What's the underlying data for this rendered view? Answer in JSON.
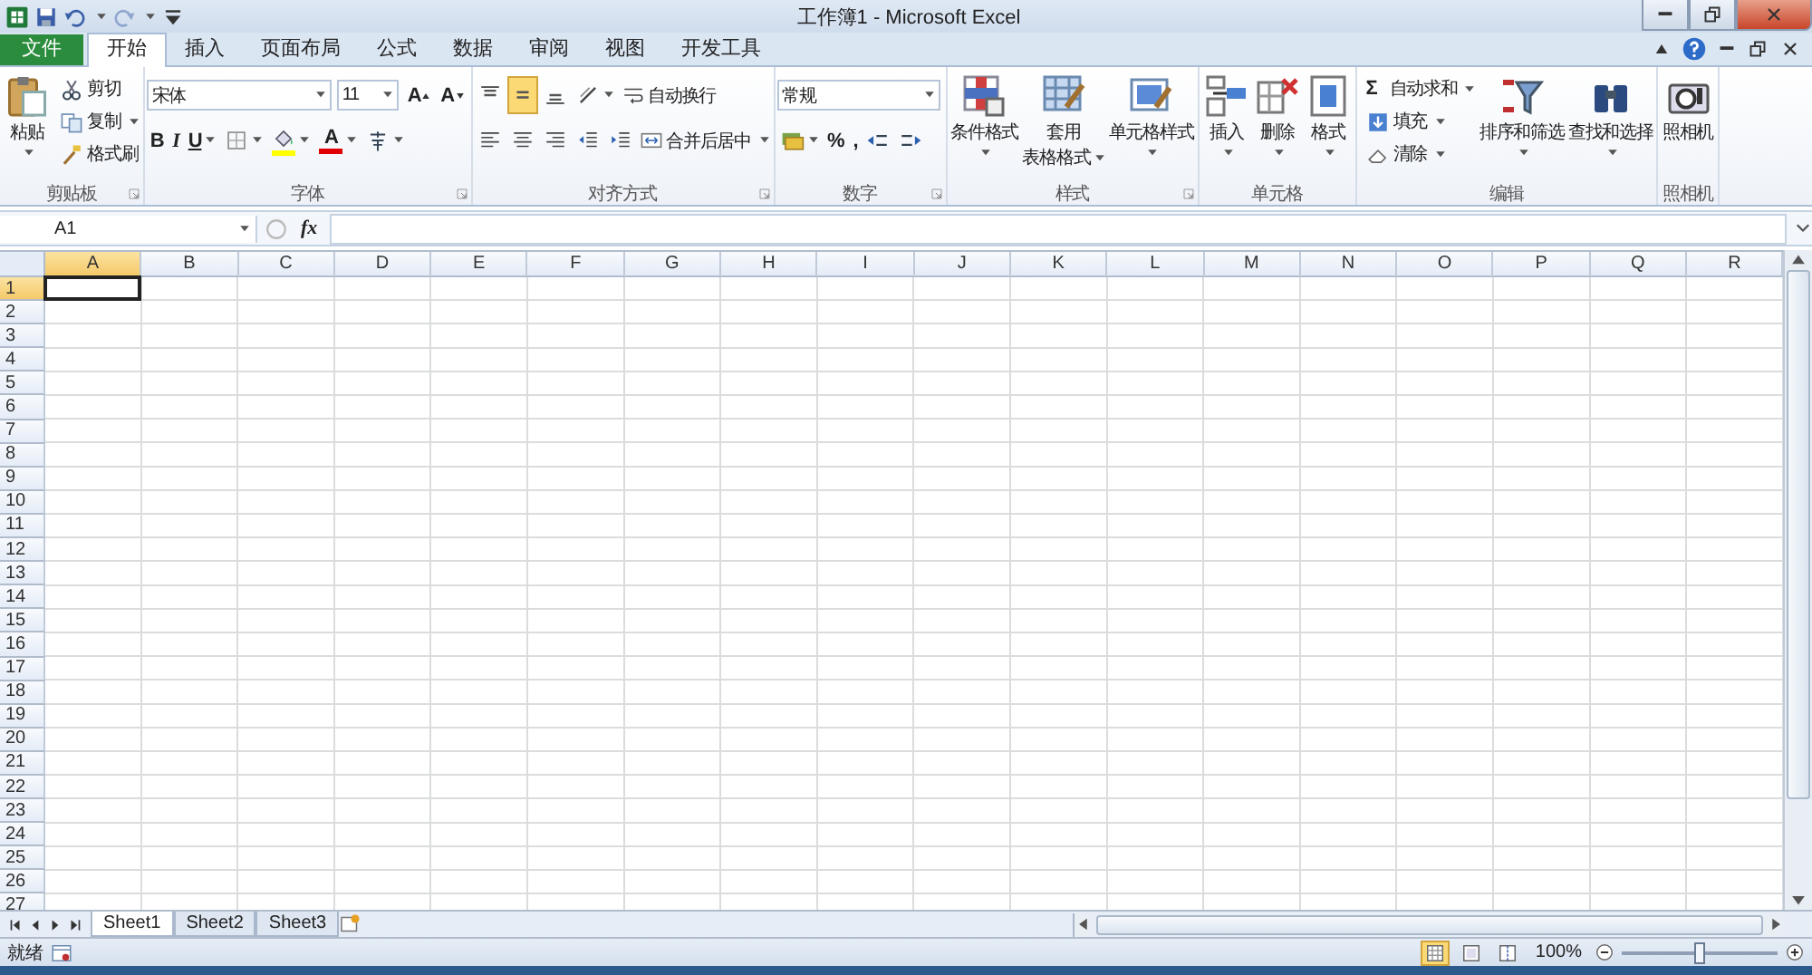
{
  "title_bar": {
    "title": "工作簿1 - Microsoft Excel",
    "quick_access": [
      {
        "disabled": false
      },
      {
        "disabled": false
      },
      {
        "disabled": false
      },
      {
        "disabled": true
      },
      {
        "disabled": false
      }
    ]
  },
  "tabs": [
    {
      "label": "文件",
      "kind": "file",
      "selected": false
    },
    {
      "label": "开始",
      "kind": "tab",
      "selected": true
    },
    {
      "label": "插入",
      "kind": "tab",
      "selected": false
    },
    {
      "label": "页面布局",
      "kind": "tab",
      "selected": false
    },
    {
      "label": "公式",
      "kind": "tab",
      "selected": false
    },
    {
      "label": "数据",
      "kind": "tab",
      "selected": false
    },
    {
      "label": "审阅",
      "kind": "tab",
      "selected": false
    },
    {
      "label": "视图",
      "kind": "tab",
      "selected": false
    },
    {
      "label": "开发工具",
      "kind": "tab",
      "selected": false
    }
  ],
  "ribbon": [
    {
      "label": "剪贴板",
      "launcher": true,
      "sections": [
        {
          "kind": "large",
          "label": "粘贴",
          "dropdown": true
        },
        {
          "kind": "stack",
          "items": [
            {
              "label": "剪切",
              "dropdown": false
            },
            {
              "label": "复制",
              "dropdown": true
            },
            {
              "label": "格式刷",
              "dropdown": false
            }
          ]
        }
      ]
    },
    {
      "label": "字体",
      "launcher": true,
      "sections": [
        {
          "kind": "lines",
          "lines": [
            {
              "tools": [
                {
                  "kind": "combo",
                  "value": "宋体"
                },
                {
                  "kind": "sizecombo",
                  "value": "11"
                },
                {
                  "kind": "grow",
                  "text": "A"
                },
                {
                  "kind": "shrink",
                  "text": "A"
                }
              ]
            },
            {
              "tools": [
                {
                  "kind": "tool",
                  "text": "B",
                  "dropdown": false
                },
                {
                  "kind": "tool",
                  "text": "I",
                  "dropdown": false
                },
                {
                  "kind": "tool",
                  "text": "U",
                  "dropdown": true
                },
                {
                  "kind": "icon",
                  "dropdown": true
                },
                {
                  "kind": "icon",
                  "dropdown": true,
                  "color": "#ffff00"
                },
                {
                  "kind": "tool",
                  "text": "A",
                  "dropdown": true,
                  "color": "#e00000"
                },
                {
                  "kind": "icon",
                  "dropdown": true
                }
              ]
            }
          ]
        }
      ]
    },
    {
      "label": "对齐方式",
      "launcher": true,
      "sections": [
        {
          "kind": "lines",
          "lines": [
            {
              "tools": [
                {
                  "kind": "icon",
                  "selected": false
                },
                {
                  "kind": "icon",
                  "selected": true
                },
                {
                  "kind": "icon",
                  "selected": false
                },
                {
                  "kind": "icon",
                  "dropdown": true
                },
                {
                  "kind": "small",
                  "label": "自动换行",
                  "dropdown": false
                }
              ]
            },
            {
              "tools": [
                {
                  "kind": "icon",
                  "selected": false
                },
                {
                  "kind": "icon",
                  "selected": false
                },
                {
                  "kind": "icon",
                  "selected": false
                },
                {
                  "kind": "icon"
                },
                {
                  "kind": "icon"
                },
                {
                  "kind": "small",
                  "label": "合并后居中",
                  "dropdown": true
                }
              ]
            }
          ]
        }
      ]
    },
    {
      "label": "数字",
      "launcher": true,
      "sections": [
        {
          "kind": "lines",
          "lines": [
            {
              "tools": [
                {
                  "kind": "numcombo",
                  "value": "常规"
                }
              ]
            },
            {
              "tools": [
                {
                  "kind": "icon",
                  "dropdown": true
                },
                {
                  "kind": "tool",
                  "text": "%",
                  "dropdown": false
                },
                {
                  "kind": "tool",
                  "text": ",",
                  "dropdown": false
                },
                {
                  "kind": "icon"
                },
                {
                  "kind": "icon"
                }
              ]
            }
          ]
        }
      ]
    },
    {
      "label": "样式",
      "launcher": true,
      "sections": [
        {
          "kind": "large",
          "label": "条件格式",
          "dropdown": true
        },
        {
          "kind": "large",
          "lines": [
            "套用",
            "表格格式"
          ],
          "dropdown": true
        },
        {
          "kind": "large",
          "label": "单元格样式",
          "dropdown": true
        }
      ]
    },
    {
      "label": "单元格",
      "sections": [
        {
          "kind": "large",
          "label": "插入",
          "dropdown": true
        },
        {
          "kind": "large",
          "label": "删除",
          "dropdown": true
        },
        {
          "kind": "large",
          "label": "格式",
          "dropdown": true
        }
      ]
    },
    {
      "label": "编辑",
      "sections": [
        {
          "kind": "stack",
          "items": [
            {
              "symbol": "Σ",
              "label": "自动求和",
              "dropdown": true
            },
            {
              "label": "填充",
              "dropdown": true
            },
            {
              "label": "清除",
              "dropdown": true
            }
          ]
        },
        {
          "kind": "large",
          "label": "排序和筛选",
          "dropdown": true
        },
        {
          "kind": "large",
          "label": "查找和选择",
          "dropdown": true
        }
      ]
    },
    {
      "label": "照相机",
      "sections": [
        {
          "kind": "large",
          "label": "照相机",
          "dropdown": false
        }
      ]
    }
  ],
  "formula_bar": {
    "name_box": "A1",
    "function_button": "fx"
  },
  "grid": {
    "columns": [
      {
        "label": "A",
        "selected": true
      },
      {
        "label": "B",
        "selected": false
      },
      {
        "label": "C",
        "selected": false
      },
      {
        "label": "D",
        "selected": false
      },
      {
        "label": "E",
        "selected": false
      },
      {
        "label": "F",
        "selected": false
      },
      {
        "label": "G",
        "selected": false
      },
      {
        "label": "H",
        "selected": false
      },
      {
        "label": "I",
        "selected": false
      },
      {
        "label": "J",
        "selected": false
      },
      {
        "label": "K",
        "selected": false
      },
      {
        "label": "L",
        "selected": false
      },
      {
        "label": "M",
        "selected": false
      },
      {
        "label": "N",
        "selected": false
      },
      {
        "label": "O",
        "selected": false
      },
      {
        "label": "P",
        "selected": false
      },
      {
        "label": "Q",
        "selected": false
      },
      {
        "label": "R",
        "selected": false
      }
    ],
    "rows": [
      {
        "label": "1",
        "selected": true
      },
      {
        "label": "2",
        "selected": false
      },
      {
        "label": "3",
        "selected": false
      },
      {
        "label": "4",
        "selected": false
      },
      {
        "label": "5",
        "selected": false
      },
      {
        "label": "6",
        "selected": false
      },
      {
        "label": "7",
        "selected": false
      },
      {
        "label": "8",
        "selected": false
      },
      {
        "label": "9",
        "selected": false
      },
      {
        "label": "10",
        "selected": false
      },
      {
        "label": "11",
        "selected": false
      },
      {
        "label": "12",
        "selected": false
      },
      {
        "label": "13",
        "selected": false
      },
      {
        "label": "14",
        "selected": false
      },
      {
        "label": "15",
        "selected": false
      },
      {
        "label": "16",
        "selected": false
      },
      {
        "label": "17",
        "selected": false
      },
      {
        "label": "18",
        "selected": false
      },
      {
        "label": "19",
        "selected": false
      },
      {
        "label": "20",
        "selected": false
      },
      {
        "label": "21",
        "selected": false
      },
      {
        "label": "22",
        "selected": false
      },
      {
        "label": "23",
        "selected": false
      },
      {
        "label": "24",
        "selected": false
      },
      {
        "label": "25",
        "selected": false
      },
      {
        "label": "26",
        "selected": false
      },
      {
        "label": "27",
        "selected": false
      }
    ]
  },
  "sheet_tabs": [
    {
      "label": "Sheet1",
      "selected": true
    },
    {
      "label": "Sheet2",
      "selected": false
    },
    {
      "label": "Sheet3",
      "selected": false
    }
  ],
  "status_bar": {
    "status": "就绪",
    "views": [
      {
        "selected": true
      },
      {
        "selected": false
      },
      {
        "selected": false
      }
    ],
    "zoom": {
      "label": "100%",
      "level": 0.5
    }
  }
}
